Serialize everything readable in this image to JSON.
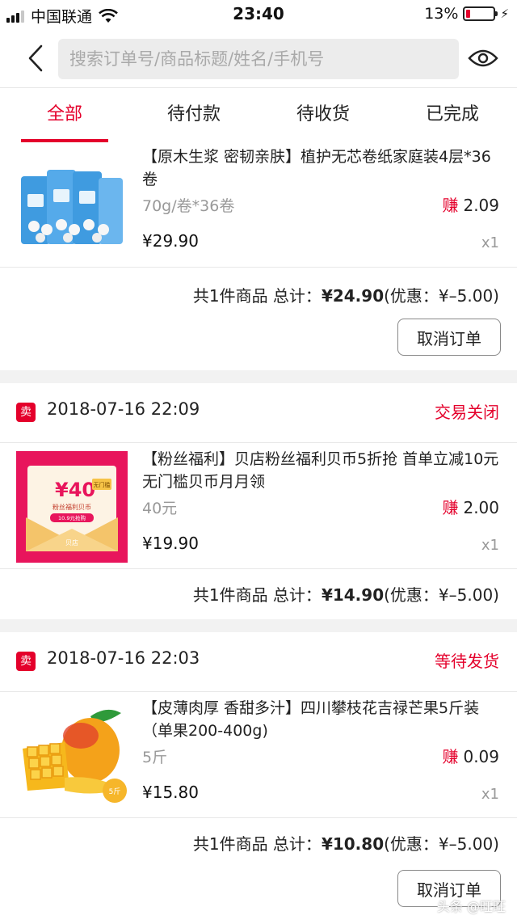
{
  "status_bar": {
    "carrier": "中国联通",
    "time": "23:40",
    "battery": "13%"
  },
  "header": {
    "search_placeholder": "搜索订单号/商品标题/姓名/手机号"
  },
  "tabs": [
    {
      "label": "全部",
      "active": true
    },
    {
      "label": "待付款",
      "active": false
    },
    {
      "label": "待收货",
      "active": false
    },
    {
      "label": "已完成",
      "active": false
    }
  ],
  "orders": [
    {
      "time": "",
      "status": "",
      "item": {
        "title": "【原木生浆 密韧亲肤】植护无芯卷纸家庭装4层*36卷",
        "spec": "70g/卷*36卷",
        "earn_label": "赚",
        "earn_value": "2.09",
        "price": "¥29.90",
        "qty": "x1"
      },
      "summary": {
        "prefix": "共1件商品 总计：",
        "total": "¥24.90",
        "discount": "(优惠：¥–5.00)"
      },
      "action": "取消订单"
    },
    {
      "seller_badge": "卖",
      "time": "2018-07-16 22:09",
      "status": "交易关闭",
      "item": {
        "title": "【粉丝福利】贝店粉丝福利贝币5折抢 首单立减10元 无门槛贝币月月领",
        "spec": "40元",
        "earn_label": "赚",
        "earn_value": "2.00",
        "price": "¥19.90",
        "qty": "x1",
        "image_text": {
          "amount": "¥40",
          "tag": "无门槛",
          "line1": "粉丝福利贝币",
          "line2": "10.9元抢购",
          "logo": "贝店"
        }
      },
      "summary": {
        "prefix": "共1件商品 总计：",
        "total": "¥14.90",
        "discount": "(优惠：¥–5.00)"
      }
    },
    {
      "seller_badge": "卖",
      "time": "2018-07-16 22:03",
      "status": "等待发货",
      "item": {
        "title": "【皮薄肉厚 香甜多汁】四川攀枝花吉禄芒果5斤装（单果200-400g)",
        "spec": "5斤",
        "earn_label": "赚",
        "earn_value": "0.09",
        "price": "¥15.80",
        "qty": "x1",
        "image_text": {
          "badge": "5斤"
        }
      },
      "summary": {
        "prefix": "共1件商品 总计：",
        "total": "¥10.80",
        "discount": "(优惠：¥–5.00)"
      },
      "action": "取消订单"
    }
  ],
  "watermark": "头条 @旺旺"
}
